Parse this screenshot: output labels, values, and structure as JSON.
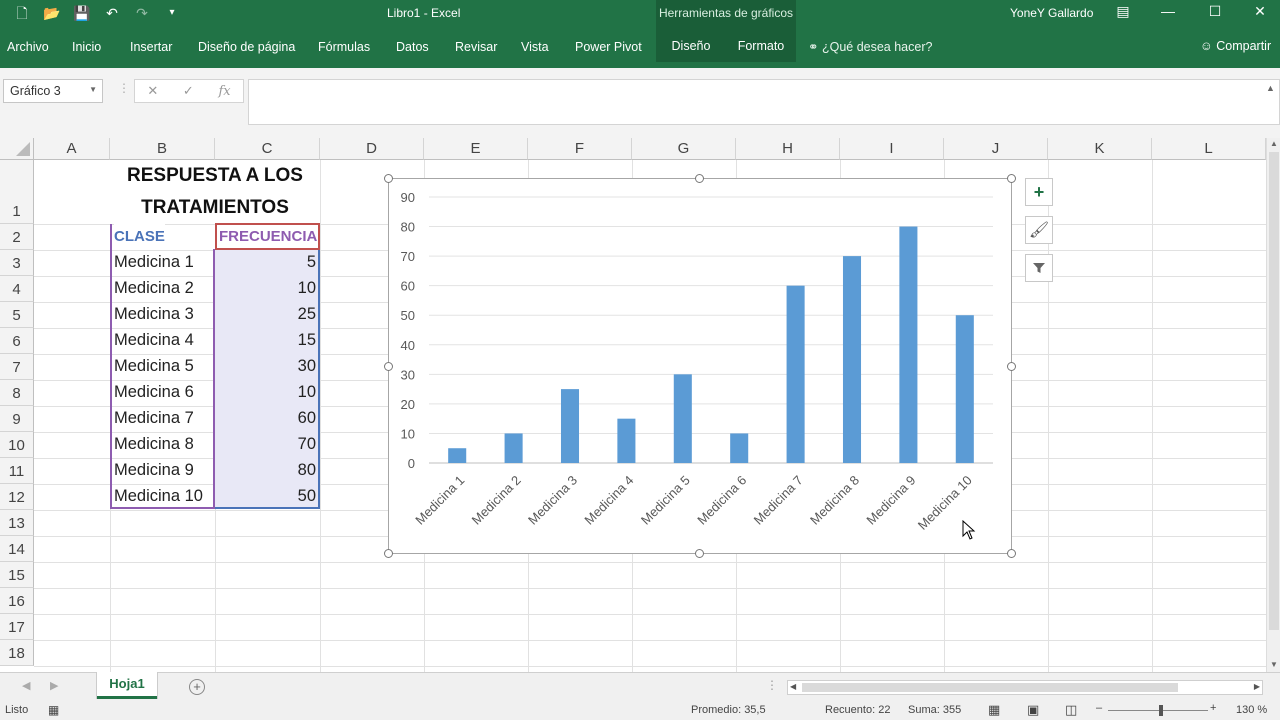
{
  "titlebar": {
    "doc_title": "Libro1  -  Excel",
    "tools_label": "Herramientas de gráficos",
    "user": "YoneY Gallardo"
  },
  "ribbon": {
    "tabs": [
      "Archivo",
      "Inicio",
      "Insertar",
      "Diseño de página",
      "Fórmulas",
      "Datos",
      "Revisar",
      "Vista",
      "Power Pivot"
    ],
    "context_tabs": [
      "Diseño",
      "Formato"
    ],
    "tell_me": "¿Qué desea hacer?",
    "share": "Compartir"
  },
  "formula_bar": {
    "name_box": "Gráfico 3",
    "formula": ""
  },
  "columns": [
    "A",
    "B",
    "C",
    "D",
    "E",
    "F",
    "G",
    "H",
    "I",
    "J",
    "K",
    "L"
  ],
  "rows": [
    "1",
    "2",
    "3",
    "4",
    "5",
    "6",
    "7",
    "8",
    "9",
    "10",
    "11",
    "12",
    "13",
    "14",
    "15",
    "16",
    "17",
    "18"
  ],
  "table": {
    "title_line1": "RESPUESTA A LOS",
    "title_line2": "TRATAMIENTOS",
    "header_class": "CLASE",
    "header_freq": "FRECUENCIA",
    "header_class_color": "#4a73b8",
    "header_freq_color": "#8e5cb0",
    "rows": [
      {
        "clase": "Medicina 1",
        "frecuencia": "5"
      },
      {
        "clase": "Medicina 2",
        "frecuencia": "10"
      },
      {
        "clase": "Medicina 3",
        "frecuencia": "25"
      },
      {
        "clase": "Medicina 4",
        "frecuencia": "15"
      },
      {
        "clase": "Medicina 5",
        "frecuencia": "30"
      },
      {
        "clase": "Medicina 6",
        "frecuencia": "10"
      },
      {
        "clase": "Medicina 7",
        "frecuencia": "60"
      },
      {
        "clase": "Medicina 8",
        "frecuencia": "70"
      },
      {
        "clase": "Medicina 9",
        "frecuencia": "80"
      },
      {
        "clase": "Medicina 10",
        "frecuencia": "50"
      }
    ]
  },
  "chart_data": {
    "type": "bar",
    "categories": [
      "Medicina 1",
      "Medicina 2",
      "Medicina 3",
      "Medicina 4",
      "Medicina 5",
      "Medicina 6",
      "Medicina 7",
      "Medicina 8",
      "Medicina 9",
      "Medicina 10"
    ],
    "values": [
      5,
      10,
      25,
      15,
      30,
      10,
      60,
      70,
      80,
      50
    ],
    "yticks": [
      0,
      10,
      20,
      30,
      40,
      50,
      60,
      70,
      80,
      90
    ],
    "ylim": [
      0,
      90
    ],
    "grid": true,
    "bar_color": "#5b9bd5",
    "title": "",
    "xlabel": "",
    "ylabel": ""
  },
  "sheet_tabs": {
    "active": "Hoja1"
  },
  "status": {
    "mode": "Listo",
    "average": "Promedio: 35,5",
    "count": "Recuento: 22",
    "sum": "Suma: 355",
    "zoom": "130 %"
  },
  "accent_color": "#217346"
}
